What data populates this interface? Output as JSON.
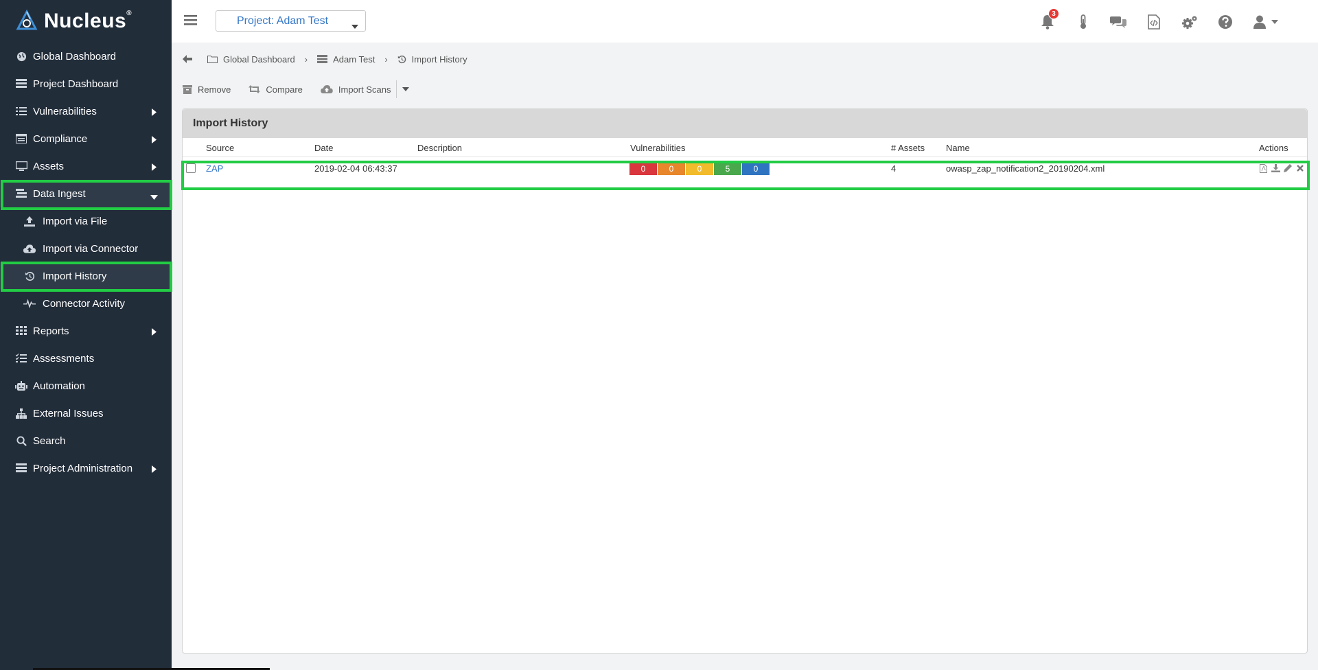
{
  "app": {
    "name": "Nucleus",
    "reg_mark": "®"
  },
  "sidebar": {
    "items": [
      {
        "label": "Global Dashboard",
        "icon": "globe-icon"
      },
      {
        "label": "Project Dashboard",
        "icon": "dashboard-icon"
      },
      {
        "label": "Vulnerabilities",
        "icon": "list-icon"
      },
      {
        "label": "Compliance",
        "icon": "compliance-icon"
      },
      {
        "label": "Assets",
        "icon": "monitor-icon"
      },
      {
        "label": "Data Ingest",
        "icon": "data-ingest-icon"
      },
      {
        "label": "Import via File",
        "icon": "upload-icon"
      },
      {
        "label": "Import via Connector",
        "icon": "cloud-upload-icon"
      },
      {
        "label": "Import History",
        "icon": "history-icon"
      },
      {
        "label": "Connector Activity",
        "icon": "pulse-icon"
      },
      {
        "label": "Reports",
        "icon": "grid-icon"
      },
      {
        "label": "Assessments",
        "icon": "checklist-icon"
      },
      {
        "label": "Automation",
        "icon": "robot-icon"
      },
      {
        "label": "External Issues",
        "icon": "sitemap-icon"
      },
      {
        "label": "Search",
        "icon": "search-icon"
      },
      {
        "label": "Project Administration",
        "icon": "admin-icon"
      }
    ]
  },
  "topbar": {
    "project_label": "Project: Adam Test",
    "notification_count": "3"
  },
  "breadcrumb": {
    "global": "Global Dashboard",
    "project": "Adam Test",
    "current": "Import History"
  },
  "toolbar": {
    "remove": "Remove",
    "compare": "Compare",
    "import_scans": "Import Scans"
  },
  "panel": {
    "title": "Import History",
    "columns": {
      "source": "Source",
      "date": "Date",
      "description": "Description",
      "vulnerabilities": "Vulnerabilities",
      "assets": "# Assets",
      "name": "Name",
      "actions": "Actions"
    },
    "rows": [
      {
        "source": "ZAP",
        "date": "2019-02-04 06:43:37",
        "description": "",
        "vulns": {
          "critical": "0",
          "high": "0",
          "medium": "0",
          "low": "5",
          "info": "0"
        },
        "assets": "4",
        "name": "owasp_zap_notification2_20190204.xml"
      }
    ]
  },
  "colors": {
    "sidebar_bg": "#222d3a",
    "highlight": "#22cc44",
    "link": "#3577c7",
    "critical": "#d9363e",
    "high": "#e8862c",
    "medium": "#f2bb2b",
    "low": "#4aa84c",
    "info": "#2f74c0"
  }
}
